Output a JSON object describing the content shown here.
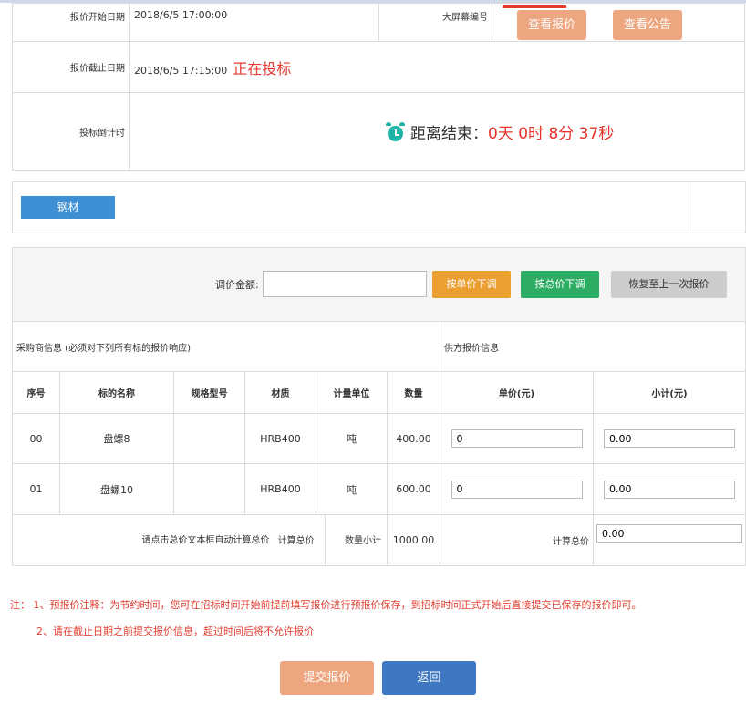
{
  "header": {
    "start_label": "报价开始日期",
    "start_value": "2018/6/5 17:00:00",
    "screen_label": "大屏幕编号",
    "view_quote_button": "查看报价",
    "view_notice_button": "查看公告",
    "end_label": "报价截止日期",
    "end_value": "2018/6/5 17:15:00",
    "status": "正在投标",
    "countdown_label": "投标倒计时",
    "countdown_prefix": "距离结束：",
    "countdown_value": "0天 0时 8分 37秒"
  },
  "category_tab": "钢材",
  "adjust": {
    "label": "调价金额:",
    "input_value": "",
    "unit_price_down": "按单价下调",
    "total_price_down": "按总价下调",
    "restore": "恢复至上一次报价"
  },
  "table": {
    "buyer_info": "采购商信息 (必须对下列所有标的报价响应)",
    "supplier_info": "供方报价信息",
    "columns": [
      "序号",
      "标的名称",
      "规格型号",
      "材质",
      "计量单位",
      "数量",
      "单价(元)",
      "小计(元)"
    ],
    "rows": [
      {
        "no": "00",
        "name": "盘螺8",
        "spec": "",
        "material": "HRB400",
        "unit": "吨",
        "qty": "400.00",
        "price": "0",
        "subtotal": "0.00"
      },
      {
        "no": "01",
        "name": "盘螺10",
        "spec": "",
        "material": "HRB400",
        "unit": "吨",
        "qty": "600.00",
        "price": "0",
        "subtotal": "0.00"
      }
    ],
    "footer": {
      "hint": "请点击总价文本框自动计算总价",
      "calc_total": "计算总价",
      "qty_subtotal_label": "数量小计",
      "qty_subtotal": "1000.00",
      "calc_total_label": "计算总价",
      "total_value": "0.00"
    }
  },
  "notes": {
    "line1": "注： 1、预报价注释：为节约时间，您可在招标时间开始前提前填写报价进行预报价保存，到招标时间正式开始后直接提交已保存的报价即可。",
    "line2": "2、请在截止日期之前提交报价信息，超过时间后将不允许报价"
  },
  "actions": {
    "submit": "提交报价",
    "back": "返回"
  },
  "colors": {
    "orange_button": "#eda67f",
    "blue_button": "#3f78c2",
    "warning_red": "#e33b2e",
    "tab_blue": "#3f8fd4",
    "clock_teal": "#1eb3a6"
  }
}
